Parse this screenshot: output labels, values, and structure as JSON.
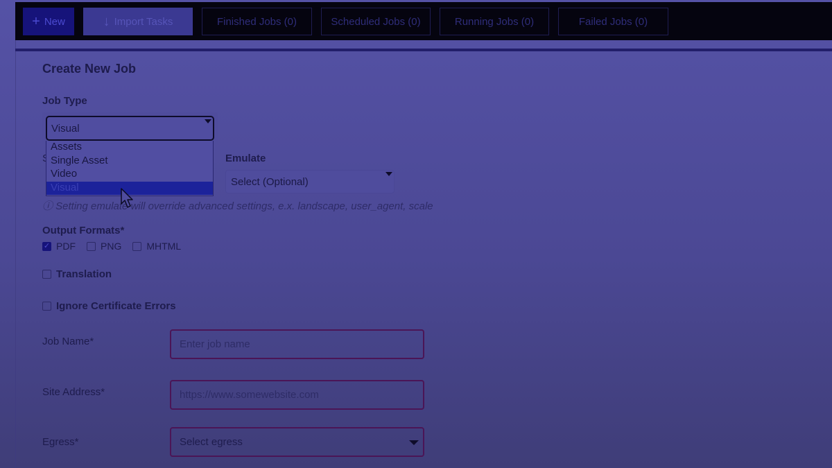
{
  "toolbar": {
    "new_label": "New",
    "new_icon": "plus-icon",
    "import_label": "Import Tasks",
    "import_icon": "arrow-down-icon",
    "tabs": [
      {
        "label": "Finished Jobs (0)"
      },
      {
        "label": "Scheduled Jobs (0)"
      },
      {
        "label": "Running Jobs (0)"
      },
      {
        "label": "Failed Jobs (0)"
      }
    ]
  },
  "form": {
    "title": "Create New Job",
    "job_type": {
      "label": "Job Type",
      "value": "Visual",
      "options": [
        "Assets",
        "Single Asset",
        "Video",
        "Visual"
      ],
      "highlighted": "Visual"
    },
    "hidden_label_fragment": "S",
    "emulate": {
      "label": "Emulate",
      "value": "Select (Optional)"
    },
    "hint": "ⓘ Setting emulate will override advanced settings, e.x. landscape, user_agent, scale",
    "output_formats": {
      "label": "Output Formats*",
      "options": [
        {
          "label": "PDF",
          "checked": true
        },
        {
          "label": "PNG",
          "checked": false
        },
        {
          "label": "MHTML",
          "checked": false
        }
      ]
    },
    "translation": {
      "label": "Translation",
      "checked": false
    },
    "ignore_cert": {
      "label": "Ignore Certificate Errors",
      "checked": false
    },
    "job_name": {
      "label": "Job Name*",
      "placeholder": "Enter job name",
      "value": ""
    },
    "site_address": {
      "label": "Site Address*",
      "placeholder": "https://www.somewebsite.com",
      "value": ""
    },
    "egress": {
      "label": "Egress*",
      "value": "Select egress"
    }
  },
  "colors": {
    "accent": "#16137a",
    "invalid_border": "#4b1556",
    "selected_option": "#1c229a"
  }
}
